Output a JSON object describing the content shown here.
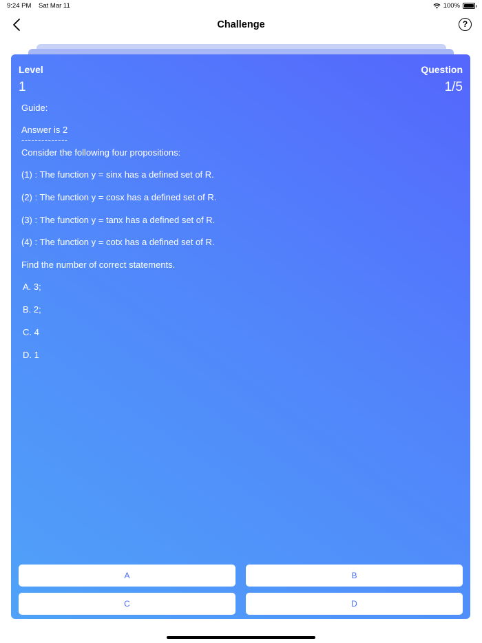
{
  "status_bar": {
    "time": "9:24 PM",
    "date": "Sat Mar 11",
    "battery": "100%"
  },
  "nav": {
    "title": "Challenge",
    "help_symbol": "?"
  },
  "card": {
    "level_label": "Level",
    "level_value": "1",
    "question_label": "Question",
    "question_value": "1/5",
    "guide_label": "Guide:",
    "answer_hint": "Answer is 2",
    "separator": "--------------",
    "prompt": "Consider the following four propositions:",
    "propositions": [
      "(1) : The function y = sinx has a defined set of R.",
      "(2) : The function y = cosx has a defined set of R.",
      "(3) : The function y = tanx has a defined set of R.",
      "(4) : The function y = cotx has a defined set of R."
    ],
    "question": "Find the number of correct statements.",
    "options": [
      "A. 3;",
      "B. 2;",
      "C. 4",
      "D. 1"
    ]
  },
  "answers": [
    "A",
    "B",
    "C",
    "D"
  ],
  "colors": {
    "card_start": "#4fa2f8",
    "card_end": "#5566fd",
    "answer_text": "#4a6ef7"
  }
}
